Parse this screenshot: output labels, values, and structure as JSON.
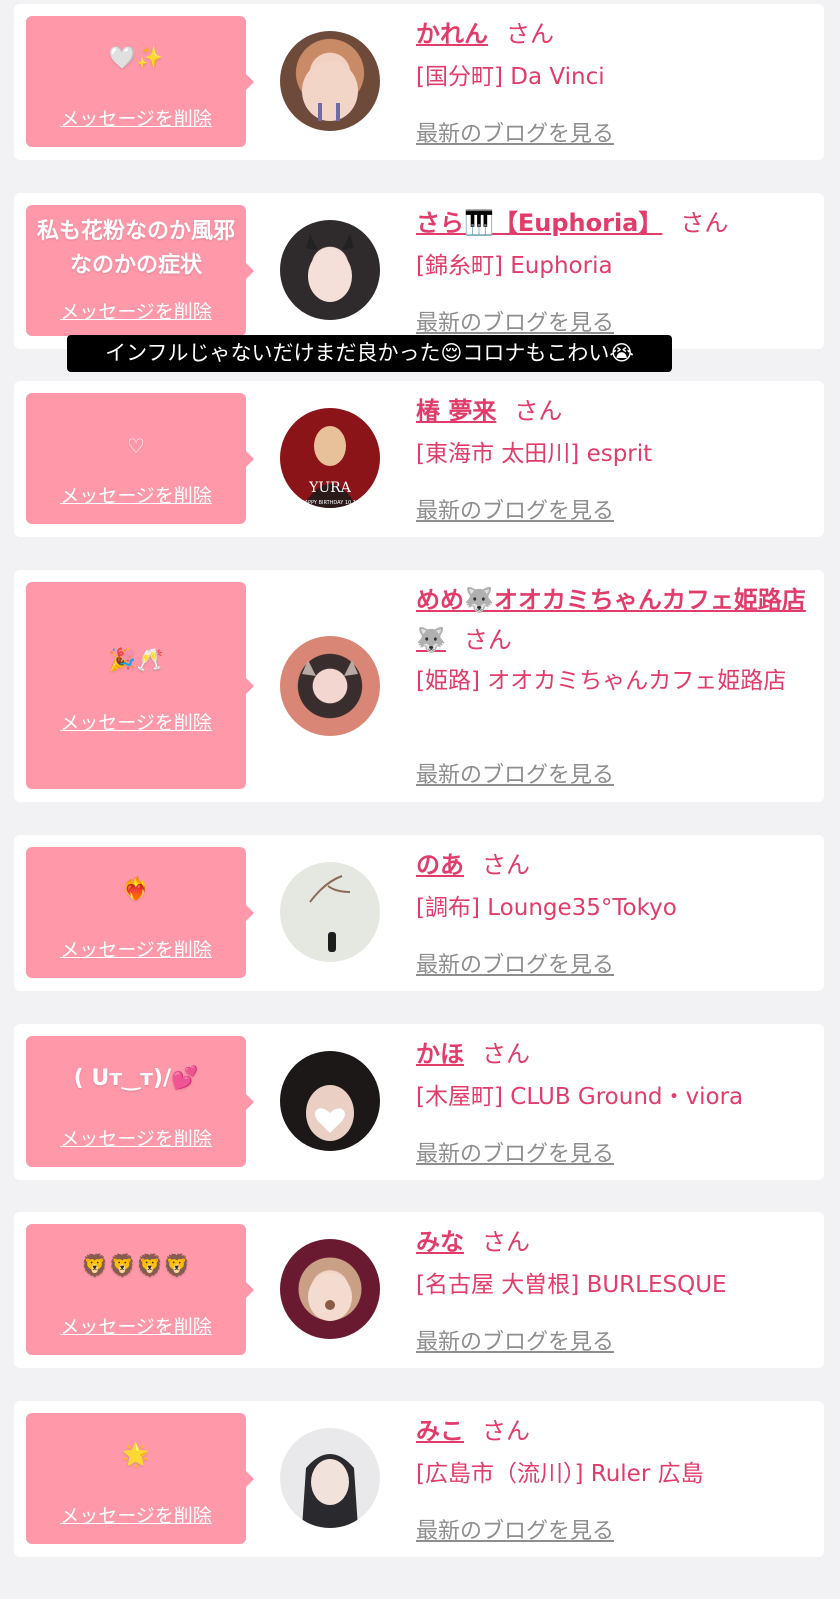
{
  "delete_label": "メッセージを削除",
  "blog_label": "最新のブログを見る",
  "san_label": "さん",
  "overlay_caption": "インフルじゃないだけまだ良かった😌コロナもこわい😭",
  "colors": {
    "accent": "#e23c6a",
    "bubble": "#ff99aa",
    "background": "#f2f2f4"
  },
  "messages": [
    {
      "bubble": "🤍✨",
      "name": "かれん",
      "shop": "[国分町] Da Vinci",
      "avatar": "profile-photo"
    },
    {
      "bubble": "私も花粉なのか風邪なのかの症状",
      "name": "さら🎹【Euphoria】",
      "shop": "[錦糸町] Euphoria",
      "avatar": "profile-photo"
    },
    {
      "bubble": "♡",
      "name": "椿 夢来",
      "shop": "[東海市 太田川] esprit",
      "avatar": "profile-photo",
      "avatar_text": "YURA",
      "avatar_subtext": "HAPPY BIRTHDAY 10.16"
    },
    {
      "bubble": "🎉🥂",
      "name": "めめ🐺オオカミちゃんカフェ姫路店🐺",
      "shop": "[姫路] オオカミちゃんカフェ姫路店",
      "avatar": "profile-photo"
    },
    {
      "bubble": "❤️‍🔥",
      "name": "のあ",
      "shop": "[調布] Lounge35°Tokyo",
      "avatar": "profile-photo"
    },
    {
      "bubble": "( Uт‿т)/💕",
      "name": "かほ",
      "shop": "[木屋町] CLUB Ground・viora",
      "avatar": "profile-photo"
    },
    {
      "bubble": "🦁🦁🦁🦁",
      "name": "みな",
      "shop": "[名古屋 大曽根] BURLESQUE",
      "avatar": "profile-photo"
    },
    {
      "bubble": "🌟",
      "name": "みこ",
      "shop": "[広島市（流川）] Ruler 広島",
      "avatar": "profile-photo"
    }
  ]
}
